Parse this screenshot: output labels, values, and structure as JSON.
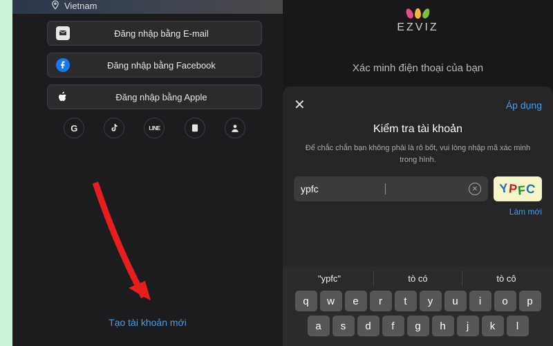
{
  "left": {
    "country": "Vietnam",
    "login": {
      "email": "Đăng nhập bằng E-mail",
      "facebook": "Đăng nhập bằng Facebook",
      "apple": "Đăng nhập bằng Apple"
    },
    "alt_icons": {
      "google": "G",
      "tiktok": "tiktok-icon",
      "line": "LINE",
      "book": "book-icon",
      "user": "user-icon"
    },
    "create_account": "Tạo tài khoản mới"
  },
  "right": {
    "brand": "EZVIZ",
    "verify_phone": "Xác minh điện thoại của bạn",
    "sheet": {
      "apply": "Áp dụng",
      "title": "Kiểm tra tài khoản",
      "desc": "Để chắc chắn bạn không phải là rô bốt, vui lòng nhập mã xác minh trong hình.",
      "input_value": "ypfc",
      "captcha_text": "YPFC",
      "refresh": "Làm mới"
    },
    "keyboard": {
      "suggestions": [
        "\"ypfc\"",
        "tò có",
        "tò cô"
      ],
      "row1": [
        "q",
        "w",
        "e",
        "r",
        "t",
        "y",
        "u",
        "i",
        "o",
        "p"
      ],
      "row2": [
        "a",
        "s",
        "d",
        "f",
        "g",
        "h",
        "j",
        "k",
        "l"
      ]
    }
  }
}
